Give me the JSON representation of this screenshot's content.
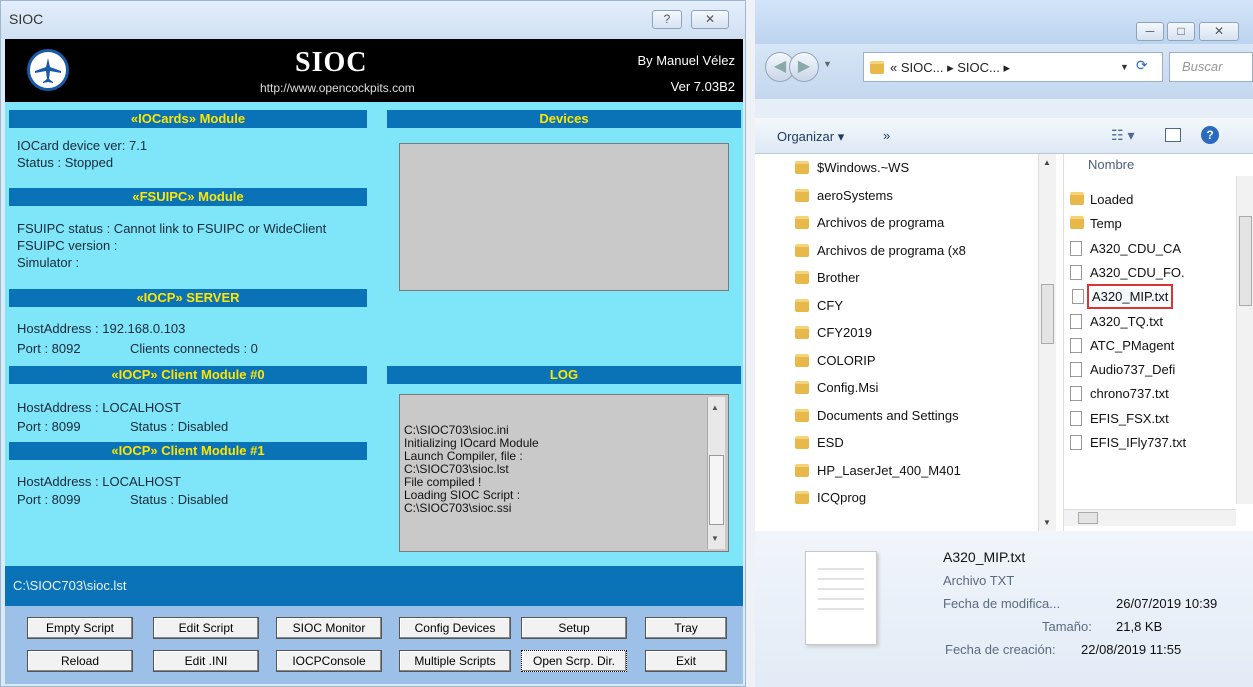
{
  "sioc": {
    "window_title": "SIOC",
    "help_glyph": "?",
    "close_glyph": "✕",
    "banner_title": "SIOC",
    "banner_url": "http://www.opencockpits.com",
    "author": "By Manuel Vélez",
    "version": "Ver 7.03B2",
    "iocards_header": "«IOCards» Module",
    "iocard_version": "IOCard device ver:  7.1",
    "iocard_status": "Status : Stopped",
    "fsuipc_header": "«FSUIPC» Module",
    "fsuipc_status": "FSUIPC status :  Cannot link to FSUIPC or WideClient",
    "fsuipc_version": "FSUIPC version :",
    "simulator": "Simulator :",
    "iocp_server_header": "«IOCP» SERVER",
    "server_host": "HostAddress :  192.168.0.103",
    "server_port": "Port :  8092",
    "server_clients": "Clients connecteds :  0",
    "client0_header": "«IOCP» Client Module #0",
    "client0_host": "HostAddress :  LOCALHOST",
    "client0_port": "Port :  8099",
    "client0_status": "Status : Disabled",
    "client1_header": "«IOCP» Client Module #1",
    "client1_host": "HostAddress :     LOCALHOST",
    "client1_port": "Port :  8099",
    "client1_status": "Status : Disabled",
    "devices_header": "Devices",
    "log_header": "LOG",
    "log_text": "C:\\SIOC703\\sioc.ini\nInitializing IOcard Module\nLaunch Compiler, file :\nC:\\SIOC703\\sioc.lst\nFile compiled !\nLoading SIOC Script :\nC:\\SIOC703\\sioc.ssi",
    "status_path": "C:\\SIOC703\\sioc.lst",
    "buttons_row1": [
      "Empty Script",
      "Edit Script",
      "SIOC Monitor",
      "Config Devices",
      "Setup",
      "Tray"
    ],
    "buttons_row2": [
      "Reload",
      "Edit .INI",
      "IOCPConsole",
      "Multiple Scripts",
      "Open Scrp. Dir.",
      "Exit"
    ]
  },
  "explorer": {
    "minimize_glyph": "─",
    "maximize_glyph": "□",
    "close_glyph": "✕",
    "breadcrumb": "« SIOC... ▸ SIOC... ▸",
    "search_placeholder": "Buscar",
    "organize_label": "Organizar ▾",
    "more_label": "»",
    "column_name": "Nombre",
    "nav_items": [
      "$Windows.~WS",
      "aeroSystems",
      "Archivos de programa",
      "Archivos de programa (x8",
      "Brother",
      "CFY",
      "CFY2019",
      "COLORIP",
      "Config.Msi",
      "Documents and Settings",
      "ESD",
      "HP_LaserJet_400_M401",
      "ICQprog"
    ],
    "files": [
      "Loaded",
      "Temp",
      "A320_CDU_CA",
      "A320_CDU_FO.",
      "A320_MIP.txt",
      "A320_TQ.txt",
      "ATC_PMagent",
      "Audio737_Defi",
      "chrono737.txt",
      "EFIS_FSX.txt",
      "EFIS_IFly737.txt"
    ],
    "selected_file": "A320_MIP.txt",
    "detail_name": "A320_MIP.txt",
    "detail_type": "Archivo TXT",
    "modified_label": "Fecha de modifica...",
    "modified_value": "26/07/2019 10:39",
    "size_label": "Tamaño:",
    "size_value": "21,8 KB",
    "created_label": "Fecha de creación:",
    "created_value": "22/08/2019 11:55"
  }
}
